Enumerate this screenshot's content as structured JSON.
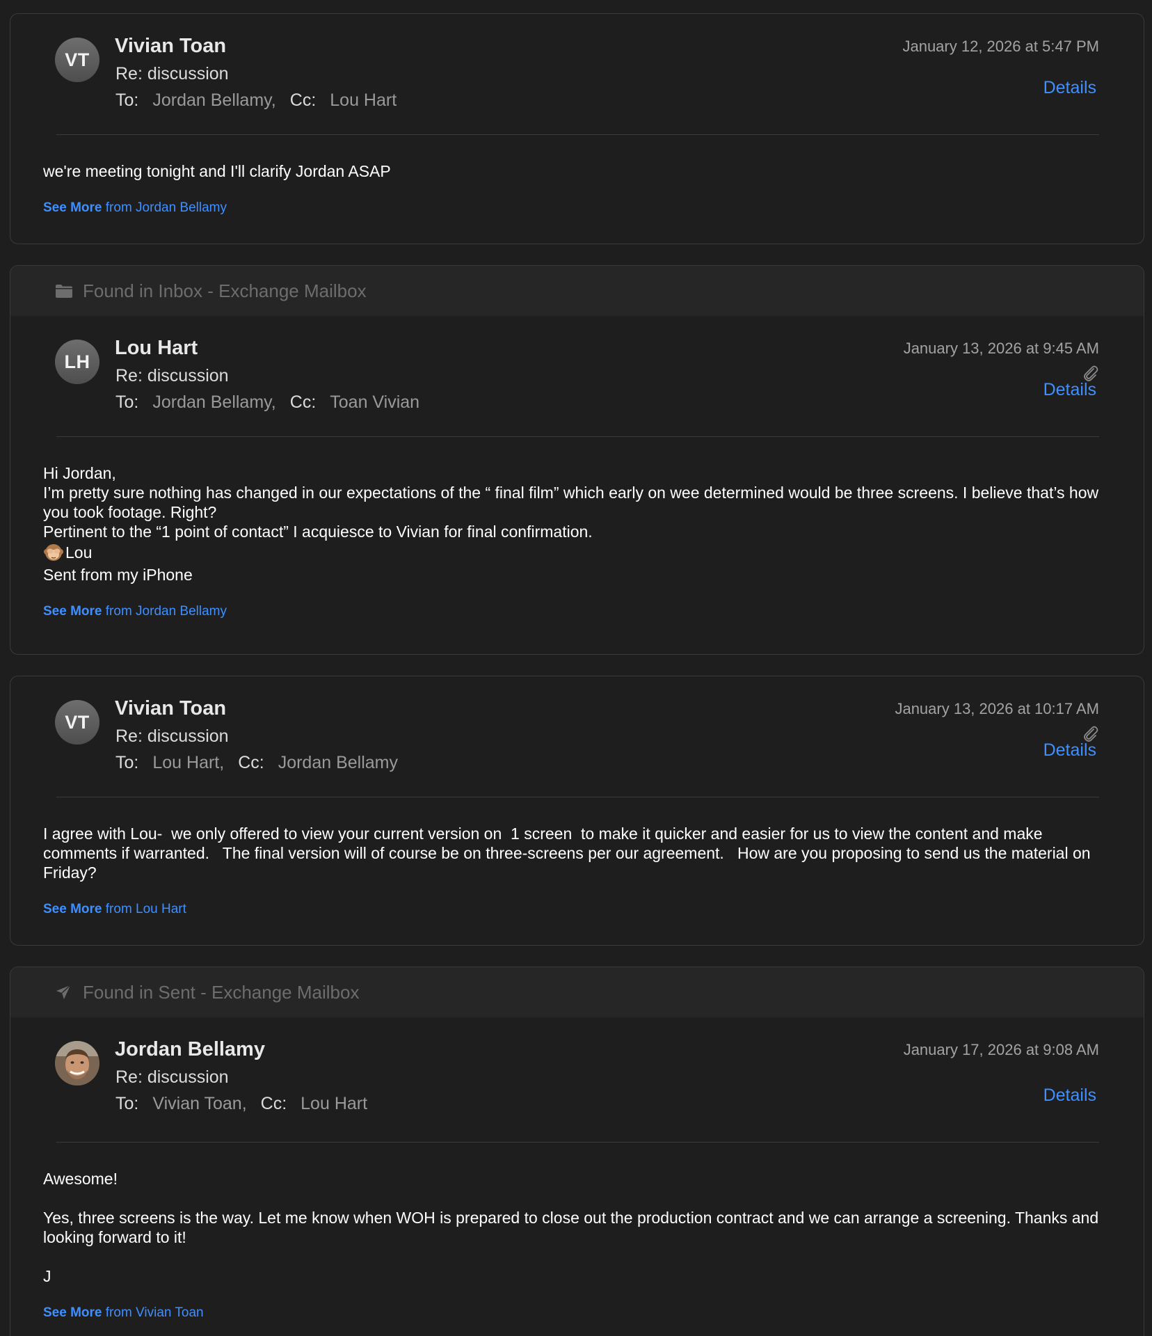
{
  "messages": [
    {
      "found_in": "",
      "initials": "VT",
      "sender": "Vivian Toan",
      "subject": "Re: discussion",
      "to_label": "To:",
      "to": "Jordan Bellamy,",
      "cc_label": "Cc:",
      "cc": "Lou Hart",
      "date": "January 12, 2026 at 5:47 PM",
      "has_attachment": false,
      "details": "Details",
      "body": [
        "we're meeting tonight and I'll clarify Jordan ASAP"
      ],
      "see_more": "See More",
      "see_more_from": "from Jordan Bellamy"
    },
    {
      "found_in": "Found in Inbox - Exchange Mailbox",
      "initials": "LH",
      "sender": "Lou Hart",
      "subject": "Re: discussion",
      "to_label": "To:",
      "to": "Jordan Bellamy,",
      "cc_label": "Cc:",
      "cc": "Toan Vivian",
      "date": "January 13, 2026 at 9:45 AM",
      "has_attachment": true,
      "details": "Details",
      "body_lines": [
        "Hi Jordan,",
        "I’m pretty sure nothing has changed in our expectations of the “ final film” which early on wee determined would be three screens. I believe that’s how you took footage. Right?",
        "Pertinent to the “1 point of contact” I acquiesce to Vivian for final confirmation.",
        "Lou",
        "Sent from my iPhone"
      ],
      "see_more": "See More",
      "see_more_from": "from Jordan Bellamy"
    },
    {
      "found_in": "",
      "initials": "VT",
      "sender": "Vivian Toan",
      "subject": "Re: discussion",
      "to_label": "To:",
      "to": "Lou Hart,",
      "cc_label": "Cc:",
      "cc": "Jordan Bellamy",
      "date": "January 13, 2026 at 10:17 AM",
      "has_attachment": true,
      "details": "Details",
      "body": [
        "I agree with Lou-  we only offered to view your current version on  1 screen  to make it quicker and easier for us to view the content and make comments if warranted.   The final version will of course be on three-screens per our agreement.   How are you proposing to send us the material on Friday?"
      ],
      "see_more": "See More",
      "see_more_from": "from Lou Hart"
    },
    {
      "found_in": "Found in Sent - Exchange Mailbox",
      "initials": "",
      "sender": "Jordan Bellamy",
      "subject": "Re: discussion",
      "to_label": "To:",
      "to": "Vivian Toan,",
      "cc_label": "Cc:",
      "cc": "Lou Hart",
      "date": "January 17, 2026 at 9:08 AM",
      "has_attachment": false,
      "details": "Details",
      "body_lines": [
        "Awesome!",
        "",
        "Yes, three screens is the way. Let me know when WOH is prepared to close out the production contract and we can arrange a screening. Thanks and looking forward to it!",
        "",
        "J"
      ],
      "see_more": "See More",
      "see_more_from": "from Vivian Toan"
    }
  ],
  "icons": {
    "folder": "folder-icon",
    "sent": "paper-plane-icon",
    "attachment": "paperclip-icon",
    "emoji": "see-no-evil-monkey-emoji"
  },
  "colors": {
    "background": "#1e1e1e",
    "link": "#3f8fff",
    "found_bar": "#262626"
  }
}
